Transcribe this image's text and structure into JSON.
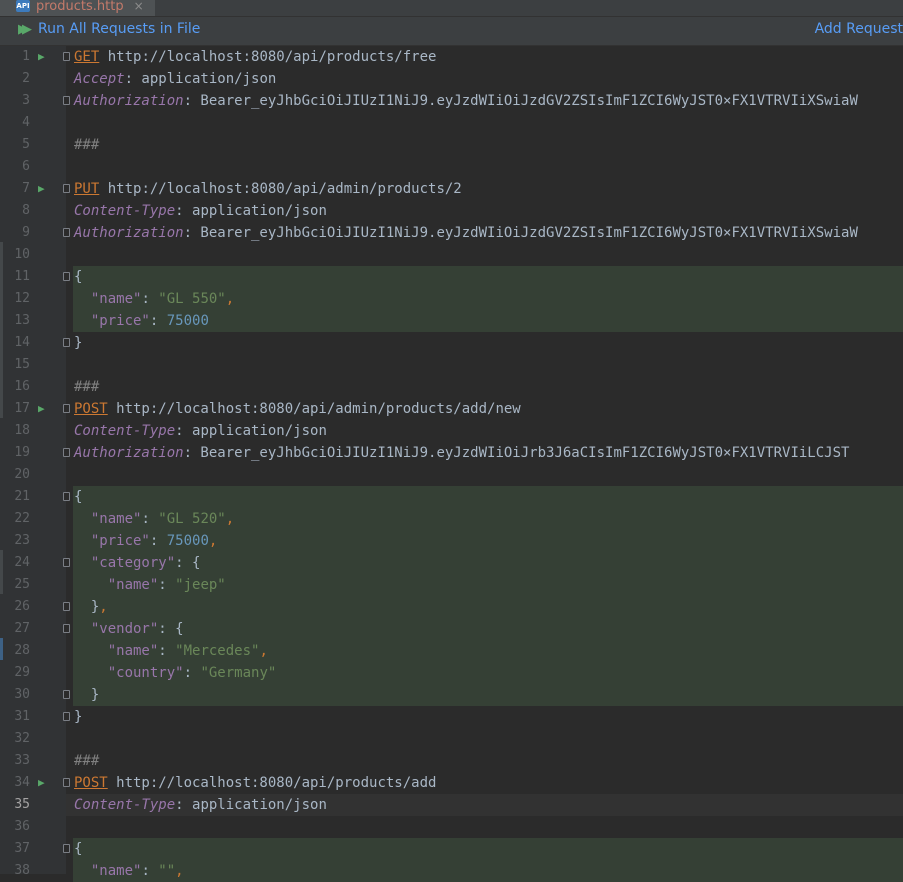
{
  "tab": {
    "icon": "API",
    "label": "products.http"
  },
  "toolbar": {
    "run_all": "Run All Requests in File",
    "add_request": "Add Request"
  },
  "lines": [
    {
      "n": "1",
      "run": true,
      "fold": true,
      "parts": [
        [
          "kw",
          "GET"
        ],
        [
          "t",
          " http://localhost:8080/api/products/free"
        ]
      ]
    },
    {
      "n": "2",
      "parts": [
        [
          "hdr",
          "Accept"
        ],
        [
          "t",
          ": application/json"
        ]
      ]
    },
    {
      "n": "3",
      "fold": true,
      "parts": [
        [
          "hdr",
          "Authorization"
        ],
        [
          "t",
          ": Bearer_eyJhbGciOiJIUzI1NiJ9.eyJzdWIiOiJzdGV2ZSIsImF1ZCI6WyJST0×FX1VTRVIiXSwiaW"
        ]
      ]
    },
    {
      "n": "4",
      "parts": []
    },
    {
      "n": "5",
      "parts": [
        [
          "sep",
          "###"
        ]
      ]
    },
    {
      "n": "6",
      "parts": []
    },
    {
      "n": "7",
      "run": true,
      "fold": true,
      "parts": [
        [
          "kw",
          "PUT"
        ],
        [
          "t",
          " http://localhost:8080/api/admin/products/2"
        ]
      ]
    },
    {
      "n": "8",
      "parts": [
        [
          "hdr",
          "Content-Type"
        ],
        [
          "t",
          ": application/json"
        ]
      ]
    },
    {
      "n": "9",
      "fold": true,
      "parts": [
        [
          "hdr",
          "Authorization"
        ],
        [
          "t",
          ": Bearer_eyJhbGciOiJIUzI1NiJ9.eyJzdWIiOiJzdGV2ZSIsImF1ZCI6WyJST0×FX1VTRVIiXSwiaW"
        ]
      ]
    },
    {
      "n": "10",
      "parts": []
    },
    {
      "n": "11",
      "json": true,
      "fold": true,
      "parts": [
        [
          "t",
          "{"
        ]
      ]
    },
    {
      "n": "12",
      "json": true,
      "parts": [
        [
          "t",
          "  "
        ],
        [
          "key",
          "\"name\""
        ],
        [
          "t",
          ": "
        ],
        [
          "str",
          "\"GL 550\""
        ],
        [
          "punct",
          ","
        ]
      ]
    },
    {
      "n": "13",
      "json": true,
      "parts": [
        [
          "t",
          "  "
        ],
        [
          "key",
          "\"price\""
        ],
        [
          "t",
          ": "
        ],
        [
          "num",
          "75000"
        ]
      ]
    },
    {
      "n": "14",
      "fold": true,
      "parts": [
        [
          "t",
          "}"
        ]
      ]
    },
    {
      "n": "15",
      "parts": []
    },
    {
      "n": "16",
      "parts": [
        [
          "sep",
          "###"
        ]
      ]
    },
    {
      "n": "17",
      "run": true,
      "fold": true,
      "parts": [
        [
          "kw",
          "POST"
        ],
        [
          "t",
          " http://localhost:8080/api/admin/products/add/new"
        ]
      ]
    },
    {
      "n": "18",
      "parts": [
        [
          "hdr",
          "Content-Type"
        ],
        [
          "t",
          ": application/json"
        ]
      ]
    },
    {
      "n": "19",
      "fold": true,
      "parts": [
        [
          "hdr",
          "Authorization"
        ],
        [
          "t",
          ": Bearer_eyJhbGciOiJIUzI1NiJ9.eyJzdWIiOiJrb3J6aCIsImF1ZCI6WyJST0×FX1VTRVIiLCJST"
        ]
      ]
    },
    {
      "n": "20",
      "parts": []
    },
    {
      "n": "21",
      "json": true,
      "fold": true,
      "parts": [
        [
          "t",
          "{"
        ]
      ]
    },
    {
      "n": "22",
      "json": true,
      "parts": [
        [
          "t",
          "  "
        ],
        [
          "key",
          "\"name\""
        ],
        [
          "t",
          ": "
        ],
        [
          "str",
          "\"GL 520\""
        ],
        [
          "punct",
          ","
        ]
      ]
    },
    {
      "n": "23",
      "json": true,
      "parts": [
        [
          "t",
          "  "
        ],
        [
          "key",
          "\"price\""
        ],
        [
          "t",
          ": "
        ],
        [
          "num",
          "75000"
        ],
        [
          "punct",
          ","
        ]
      ]
    },
    {
      "n": "24",
      "json": true,
      "fold": true,
      "parts": [
        [
          "t",
          "  "
        ],
        [
          "key",
          "\"category\""
        ],
        [
          "t",
          ": {"
        ]
      ]
    },
    {
      "n": "25",
      "json": true,
      "parts": [
        [
          "t",
          "    "
        ],
        [
          "key",
          "\"name\""
        ],
        [
          "t",
          ": "
        ],
        [
          "str",
          "\"jeep\""
        ]
      ]
    },
    {
      "n": "26",
      "json": true,
      "fold": true,
      "parts": [
        [
          "t",
          "  }"
        ],
        [
          "punct",
          ","
        ]
      ]
    },
    {
      "n": "27",
      "json": true,
      "fold": true,
      "parts": [
        [
          "t",
          "  "
        ],
        [
          "key",
          "\"vendor\""
        ],
        [
          "t",
          ": {"
        ]
      ]
    },
    {
      "n": "28",
      "json": true,
      "parts": [
        [
          "t",
          "    "
        ],
        [
          "key",
          "\"name\""
        ],
        [
          "t",
          ": "
        ],
        [
          "str",
          "\"Mercedes\""
        ],
        [
          "punct",
          ","
        ]
      ]
    },
    {
      "n": "29",
      "json": true,
      "parts": [
        [
          "t",
          "    "
        ],
        [
          "key",
          "\"country\""
        ],
        [
          "t",
          ": "
        ],
        [
          "str",
          "\"Germany\""
        ]
      ]
    },
    {
      "n": "30",
      "json": true,
      "fold": true,
      "parts": [
        [
          "t",
          "  }"
        ]
      ]
    },
    {
      "n": "31",
      "fold": true,
      "parts": [
        [
          "t",
          "}"
        ]
      ]
    },
    {
      "n": "32",
      "parts": []
    },
    {
      "n": "33",
      "parts": [
        [
          "sep",
          "###"
        ]
      ]
    },
    {
      "n": "34",
      "run": true,
      "fold": true,
      "parts": [
        [
          "kw",
          "POST"
        ],
        [
          "t",
          " http://localhost:8080/api/products/add"
        ]
      ]
    },
    {
      "n": "35",
      "current": true,
      "parts": [
        [
          "hdr",
          "Content-Type"
        ],
        [
          "t",
          ": application/json"
        ]
      ]
    },
    {
      "n": "36",
      "parts": []
    },
    {
      "n": "37",
      "json": true,
      "fold": true,
      "parts": [
        [
          "t",
          "{"
        ]
      ]
    },
    {
      "n": "38",
      "json": true,
      "parts": [
        [
          "t",
          "  "
        ],
        [
          "key",
          "\"name\""
        ],
        [
          "t",
          ": "
        ],
        [
          "str",
          "\"\""
        ],
        [
          "punct",
          ","
        ]
      ]
    }
  ]
}
